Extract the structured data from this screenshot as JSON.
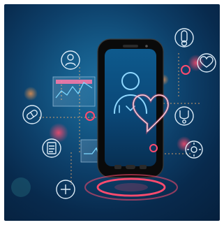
{
  "image": {
    "subject": "telemedicine-smartphone",
    "icons": [
      "user-icon",
      "document-icon",
      "pill-icon",
      "heart-icon",
      "thermometer-icon",
      "plus-icon",
      "stethoscope-icon",
      "gear-icon"
    ],
    "colors": {
      "background_deep": "#06203d",
      "background_glow": "#1f6f9f",
      "neon_pink": "#ff4b6e",
      "neon_orange": "#ff9a4b",
      "line_white": "#cfe9ff",
      "phone_body": "#111111",
      "phone_screen": "#0d3c6b",
      "ecg_line": "#7fd9ff"
    }
  }
}
